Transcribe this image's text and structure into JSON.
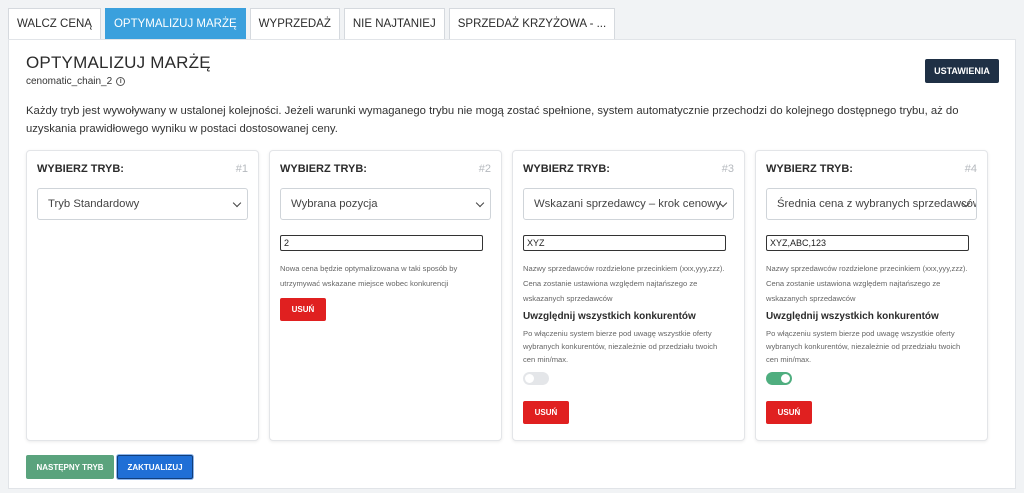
{
  "tabs": [
    {
      "label": "WALCZ CENĄ",
      "active": false
    },
    {
      "label": "OPTYMALIZUJ MARŻĘ",
      "active": true
    },
    {
      "label": "WYPRZEDAŻ",
      "active": false
    },
    {
      "label": "NIE NAJTANIEJ",
      "active": false
    },
    {
      "label": "SPRZEDAŻ KRZYŻOWA - ...",
      "active": false
    }
  ],
  "header": {
    "title": "OPTYMALIZUJ MARŻĘ",
    "subtitle": "cenomatic_chain_2",
    "info_icon": "i",
    "settings_label": "USTAWIENIA"
  },
  "description": "Każdy tryb jest wywoływany w ustalonej kolejności. Jeżeli warunki wymaganego trybu nie mogą zostać spełnione, system automatycznie przechodzi do kolejnego dostępnego trybu, aż do uzyskania prawidłowego wyniku w postaci dostosowanej ceny.",
  "cards": [
    {
      "heading": "WYBIERZ TRYB:",
      "number": "#1",
      "select": "Tryb Standardowy"
    },
    {
      "heading": "WYBIERZ TRYB:",
      "number": "#2",
      "select": "Wybrana pozycja",
      "input": "2",
      "hint": "Nowa cena będzie optymalizowana w taki sposób by utrzymywać wskazane miejsce wobec konkurencji",
      "delete_label": "USUŃ"
    },
    {
      "heading": "WYBIERZ TRYB:",
      "number": "#3",
      "select": "Wskazani sprzedawcy – krok cenowy",
      "input": "XYZ",
      "hint": "Nazwy sprzedawców rozdzielone przecinkiem (xxx,yyy,zzz). Cena zostanie ustawiona względem najtańszego ze wskazanych sprzedawców",
      "option_title": "Uwzględnij wszystkich konkurentów",
      "option_desc": "Po włączeniu system bierze pod uwagę wszystkie oferty wybranych konkurentów, niezależnie od przedziału twoich cen min/max.",
      "toggle_on": false,
      "delete_label": "USUŃ"
    },
    {
      "heading": "WYBIERZ TRYB:",
      "number": "#4",
      "select": "Średnia cena z wybranych sprzedawców",
      "input": "XYZ,ABC,123",
      "hint": "Nazwy sprzedawców rozdzielone przecinkiem (xxx,yyy,zzz). Cena zostanie ustawiona względem najtańszego ze wskazanych sprzedawców",
      "option_title": "Uwzględnij wszystkich konkurentów",
      "option_desc": "Po włączeniu system bierze pod uwagę wszystkie oferty wybranych konkurentów, niezależnie od przedziału twoich cen min/max.",
      "toggle_on": true,
      "delete_label": "USUŃ"
    }
  ],
  "footer": {
    "next_label": "NASTĘPNY TRYB",
    "update_label": "ZAKTUALIZUJ"
  },
  "colors": {
    "active_tab": "#3aa0dd",
    "settings_button": "#1f3045",
    "delete_button": "#e02020",
    "next_button": "#5aa37d",
    "update_button": "#1f6fd6",
    "toggle_on": "#4fae7f"
  }
}
